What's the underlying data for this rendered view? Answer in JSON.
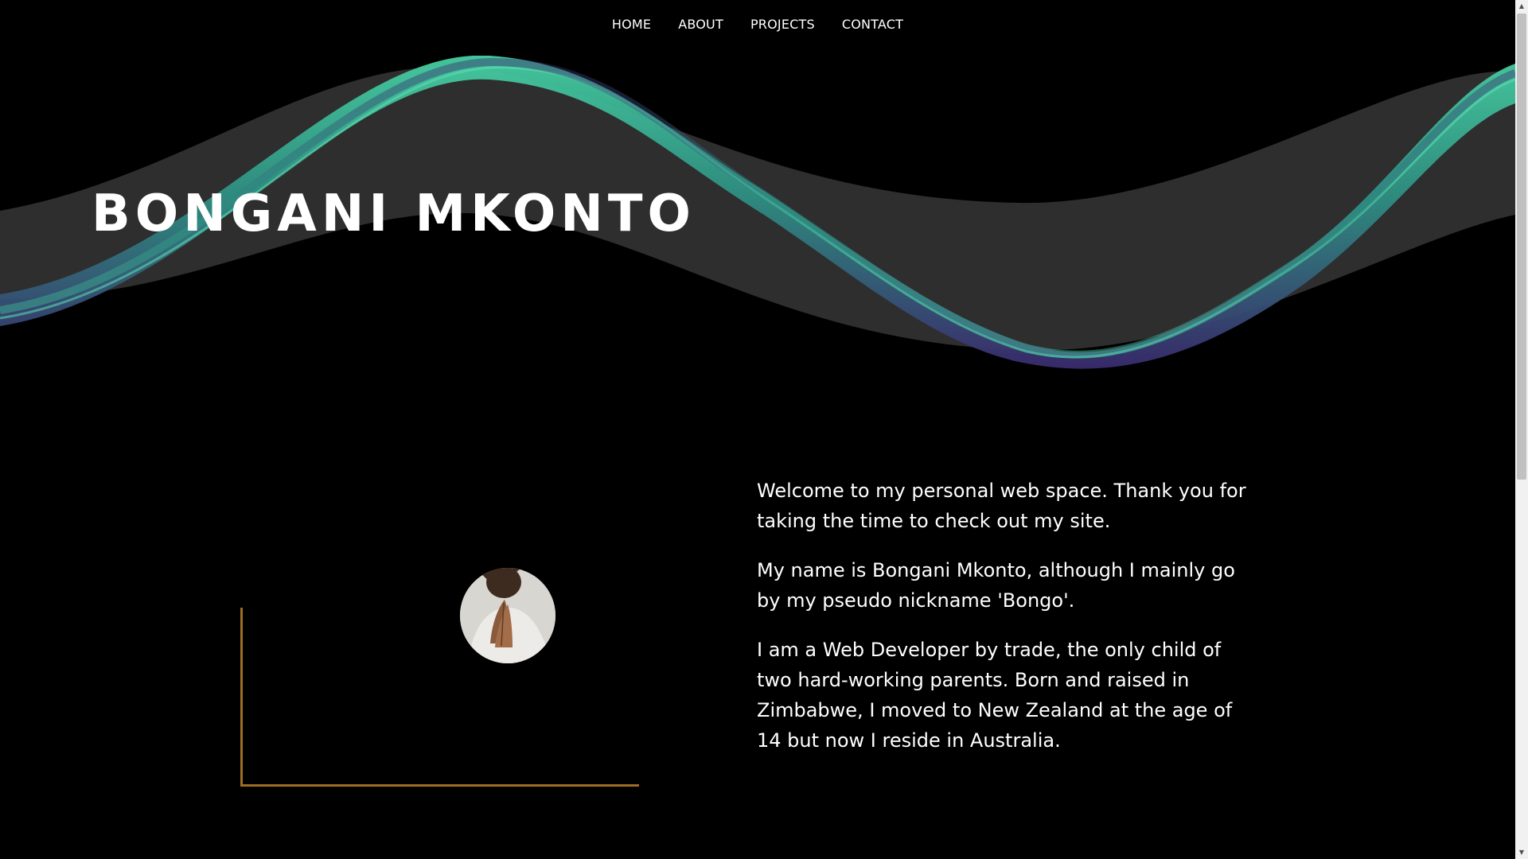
{
  "nav": {
    "items": [
      {
        "label": "HOME"
      },
      {
        "label": "ABOUT"
      },
      {
        "label": "PROJECTS"
      },
      {
        "label": "CONTACT"
      }
    ]
  },
  "hero": {
    "title": "BONGANI MKONTO"
  },
  "about": {
    "paragraphs": [
      "Welcome to my personal web space. Thank you for taking the time to check out my site.",
      "My name is Bongani Mkonto, although I mainly go by my pseudo nickname 'Bongo'.",
      "I am a Web Developer by trade, the only child of two hard-working parents. Born and raised in Zimbabwe, I moved to New Zealand at the age of 14 but now I reside in Australia."
    ],
    "photo_icon": "profile-photo"
  },
  "colors": {
    "background": "#000000",
    "wave_green": "#3fc59a",
    "wave_purple": "#3d2f70",
    "wave_grey": "#2e2e2e",
    "frame_accent": "#a06d24"
  },
  "scrollbar": {
    "up_icon": "chevron-up-icon",
    "down_icon": "chevron-down-icon"
  }
}
